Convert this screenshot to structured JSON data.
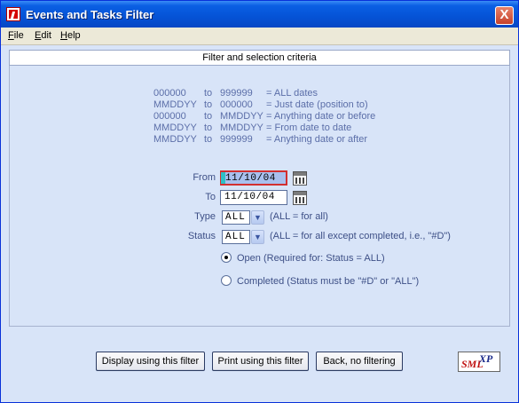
{
  "window": {
    "title": "Events and Tasks Filter",
    "close_label": "X"
  },
  "menu": [
    {
      "accel": "F",
      "rest": "ile"
    },
    {
      "accel": "E",
      "rest": "dit"
    },
    {
      "accel": "H",
      "rest": "elp"
    }
  ],
  "header": {
    "title": "Filter and selection criteria"
  },
  "help_rows": [
    {
      "from": "000000",
      "to_word": "to",
      "to": "999999",
      "desc": "= ALL dates"
    },
    {
      "from": "MMDDYY",
      "to_word": "to",
      "to": "000000",
      "desc": "= Just date (position to)"
    },
    {
      "from": "000000",
      "to_word": "to",
      "to": "MMDDYY",
      "desc": "= Anything date or before"
    },
    {
      "from": "MMDDYY",
      "to_word": "to",
      "to": "MMDDYY",
      "desc": "= From date to date"
    },
    {
      "from": "MMDDYY",
      "to_word": "to",
      "to": "999999",
      "desc": "= Anything date or after"
    }
  ],
  "form": {
    "from_label": "From",
    "from_value": "11/10/04",
    "to_label": "To",
    "to_value": "11/10/04",
    "type_label": "Type",
    "type_value": "ALL",
    "type_note": "(ALL = for all)",
    "status_label": "Status",
    "status_value": "ALL",
    "status_note": "(ALL = for all except completed, i.e., \"#D\")",
    "open_label": "Open  (Required for: Status = ALL)",
    "open_selected": true,
    "completed_label": "Completed (Status must be \"#D\" or \"ALL\")",
    "completed_selected": false
  },
  "buttons": {
    "display": "Display using this filter",
    "print": "Print using this filter",
    "back": "Back, no filtering"
  },
  "logo": {
    "text_main": "SML",
    "text_sup": "XP"
  },
  "icons": {
    "app": "app-icon",
    "calendar": "calendar-icon",
    "dropdown": "chevron-down-icon"
  },
  "colors": {
    "title_bar": "#0553d6",
    "panel": "#d8e4f8",
    "help_text": "#5b6ea8",
    "accent_red": "#d23030"
  }
}
